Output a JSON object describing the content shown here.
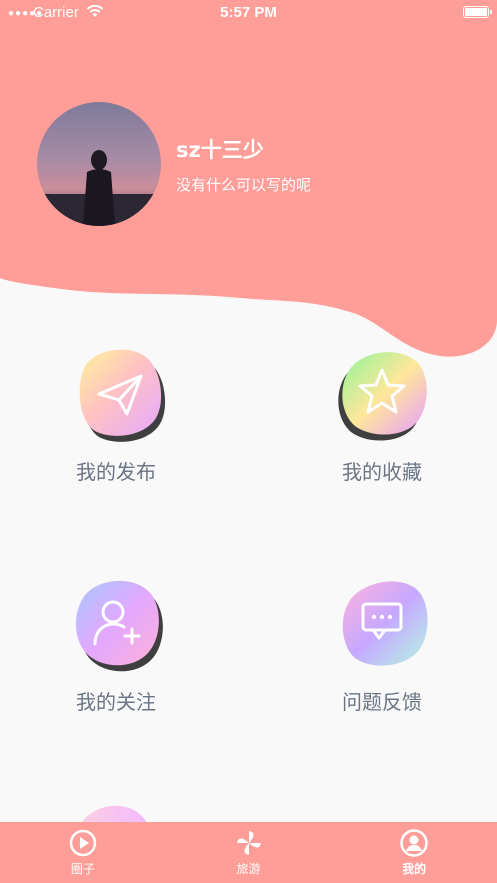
{
  "status_bar": {
    "carrier": "Carrier",
    "time": "5:57 PM"
  },
  "colors": {
    "header": "#ff9e98",
    "background": "#f9f9f9",
    "menu_label": "#6b7585",
    "tab_text": "#ffffff"
  },
  "profile": {
    "username": "sz十三少",
    "bio": "没有什么可以写的呢"
  },
  "menu": {
    "publish": {
      "label": "我的发布",
      "icon": "paper-plane-icon"
    },
    "favorites": {
      "label": "我的收藏",
      "icon": "star-icon"
    },
    "following": {
      "label": "我的关注",
      "icon": "add-user-icon"
    },
    "feedback": {
      "label": "问题反馈",
      "icon": "chat-bubble-icon"
    }
  },
  "tabbar": {
    "circle": {
      "label": "圈子",
      "icon": "play-circle-icon"
    },
    "travel": {
      "label": "旅游",
      "icon": "pinwheel-icon"
    },
    "mine": {
      "label": "我的",
      "icon": "user-circle-icon",
      "active": true
    }
  }
}
